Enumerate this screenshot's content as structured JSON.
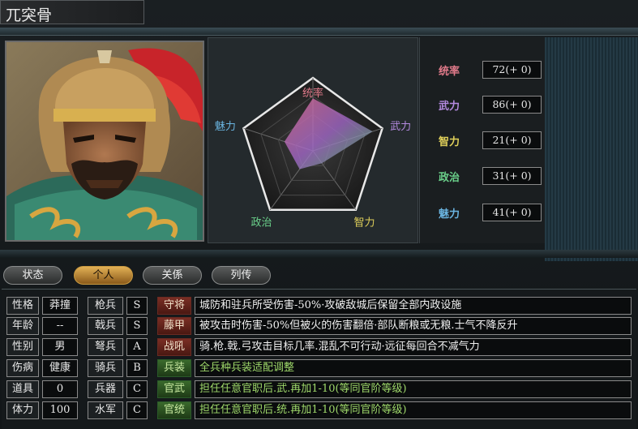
{
  "window": {
    "title": "兀突骨"
  },
  "radar": {
    "labels": {
      "tongshuai": "统率",
      "wuli": "武力",
      "zhili": "智力",
      "zhengzhi": "政治",
      "meili": "魅力"
    },
    "values": {
      "tongshuai": 72,
      "wuli": 86,
      "zhili": 21,
      "zhengzhi": 31,
      "meili": 41
    },
    "max": 100
  },
  "stats": [
    {
      "label": "统率",
      "value": "72(+ 0)",
      "color": "#e07a8a"
    },
    {
      "label": "武力",
      "value": "86(+ 0)",
      "color": "#b48ae0"
    },
    {
      "label": "智力",
      "value": "21(+ 0)",
      "color": "#e0d05a"
    },
    {
      "label": "政治",
      "value": "31(+ 0)",
      "color": "#6ad08a"
    },
    {
      "label": "魅力",
      "value": "41(+ 0)",
      "color": "#6ab4e0"
    }
  ],
  "tabs": [
    {
      "label": "状态",
      "active": false
    },
    {
      "label": "个人",
      "active": true
    },
    {
      "label": "关係",
      "active": false
    },
    {
      "label": "列传",
      "active": false
    }
  ],
  "personal": [
    {
      "label": "性格",
      "value": "莽撞"
    },
    {
      "label": "年龄",
      "value": "--"
    },
    {
      "label": "性别",
      "value": "男"
    },
    {
      "label": "伤病",
      "value": "健康"
    },
    {
      "label": "道具",
      "value": "0"
    },
    {
      "label": "体力",
      "value": "100"
    }
  ],
  "aptitude": [
    {
      "label": "枪兵",
      "value": "S"
    },
    {
      "label": "戟兵",
      "value": "S"
    },
    {
      "label": "弩兵",
      "value": "A"
    },
    {
      "label": "骑兵",
      "value": "B"
    },
    {
      "label": "兵器",
      "value": "C"
    },
    {
      "label": "水军",
      "value": "C"
    }
  ],
  "skills": [
    {
      "name": "守将",
      "desc": "城防和驻兵所受伤害-50%·攻破敌城后保留全部内政设施",
      "green": false
    },
    {
      "name": "藤甲",
      "desc": "被攻击时伤害-50%但被火的伤害翻倍·部队断粮或无粮.士气不降反升",
      "green": false
    },
    {
      "name": "战吼",
      "desc": "骑.枪.戟.弓攻击目标几率.混乱不可行动·远征每回合不减气力",
      "green": false
    },
    {
      "name": "兵装",
      "desc": "全兵种兵装适配调整",
      "green": true
    },
    {
      "name": "官武",
      "desc": "担任任意官职后.武.再加1-10(等同官阶等级)",
      "green": true
    },
    {
      "name": "官统",
      "desc": "担任任意官职后.统.再加1-10(等同官阶等级)",
      "green": true
    }
  ],
  "colors": {
    "accent_tab": "#d4a040",
    "radar_fill_top": "#e07a8a",
    "radar_fill_right": "#b48ae0"
  }
}
